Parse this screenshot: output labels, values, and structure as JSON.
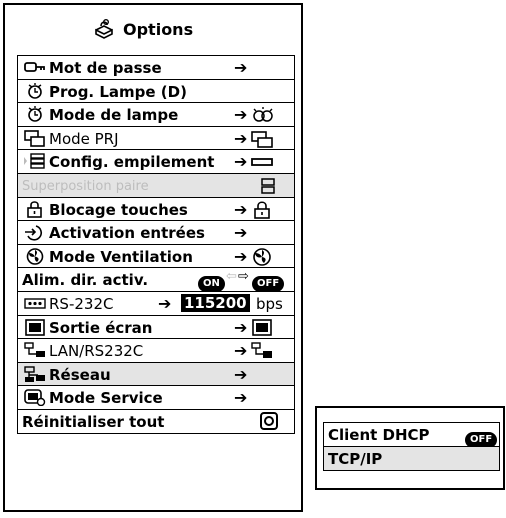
{
  "header": {
    "title": "Options",
    "icon": "options-icon"
  },
  "rows": [
    {
      "label": "Mot de passe",
      "icon": "password-key-icon",
      "arrow": "➔",
      "right_icon": ""
    },
    {
      "label": "Prog. Lampe (D)",
      "icon": "lamp-timer-icon",
      "arrow": "",
      "right_icon": ""
    },
    {
      "label": "Mode de lampe",
      "icon": "lamp-timer-icon",
      "arrow": "➔",
      "right_icon": "lamp-mode-icon"
    },
    {
      "label": "Mode PRJ",
      "icon": "projector-mode-icon",
      "arrow": "➔",
      "right_icon": "projector-mode-icon"
    },
    {
      "label": "Config. empilement",
      "icon": "stack-setup-icon",
      "arrow": "➔",
      "right_icon": "stack-bar-icon"
    },
    {
      "label": "Superposition paire",
      "icon": "",
      "arrow": "",
      "right_icon": "stack-pair-icon",
      "disabled": true
    },
    {
      "label": "Blocage touches",
      "icon": "lock-icon",
      "arrow": "➔",
      "right_icon": "lock-icon"
    },
    {
      "label": "Activation entrées",
      "icon": "input-activation-icon",
      "arrow": "➔",
      "right_icon": ""
    },
    {
      "label": "Mode Ventilation",
      "icon": "fan-icon",
      "arrow": "➔",
      "right_icon": "fan-icon"
    },
    {
      "label": "Alim. dir. activ.",
      "icon": "",
      "pill_on": "ON",
      "pill_off": "OFF"
    },
    {
      "label": "RS-232C",
      "icon": "rs232c-port-icon",
      "arrow": "➔",
      "baud": "115200",
      "unit": "bps"
    },
    {
      "label": "Sortie écran",
      "icon": "monitor-out-icon",
      "arrow": "➔",
      "right_icon": "monitor-out-icon"
    },
    {
      "label": "LAN/RS232C",
      "icon": "lan-rs232c-icon",
      "arrow": "➔",
      "right_icon": "lan-rs232c-icon"
    },
    {
      "label": "Réseau",
      "icon": "network-icon",
      "arrow": "➔",
      "right_icon": "",
      "selected": true
    },
    {
      "label": "Mode Service",
      "icon": "service-mode-icon",
      "arrow": "➔",
      "right_icon": ""
    },
    {
      "label": "Réinitialiser tout",
      "icon": "",
      "right_icon": "reset-icon"
    }
  ],
  "submenu": {
    "items": [
      {
        "label": "Client DHCP",
        "pill": "OFF"
      },
      {
        "label": "TCP/IP"
      }
    ]
  }
}
